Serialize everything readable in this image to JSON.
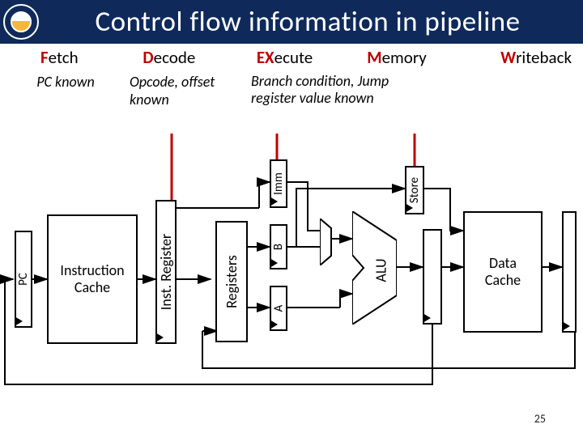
{
  "title": "Control flow information in pipeline",
  "stages": [
    {
      "first": "F",
      "rest": "etch"
    },
    {
      "first": "D",
      "rest": "ecode"
    },
    {
      "first": "EX",
      "rest": "ecute"
    },
    {
      "first": "M",
      "rest": "emory"
    },
    {
      "first": "W",
      "rest": "riteback"
    }
  ],
  "notes": {
    "fetch": "PC known",
    "decode": "Opcode, offset known",
    "execute": "Branch condition, Jump register value known"
  },
  "blocks": {
    "pc": "PC",
    "icache": "Instruction\nCache",
    "ir": "Inst. Register",
    "regfile": "Registers",
    "a": "A",
    "b": "B",
    "imm": "Imm",
    "alu": "ALU",
    "store": "Store",
    "dcache": "Data\nCache"
  },
  "page": "25"
}
